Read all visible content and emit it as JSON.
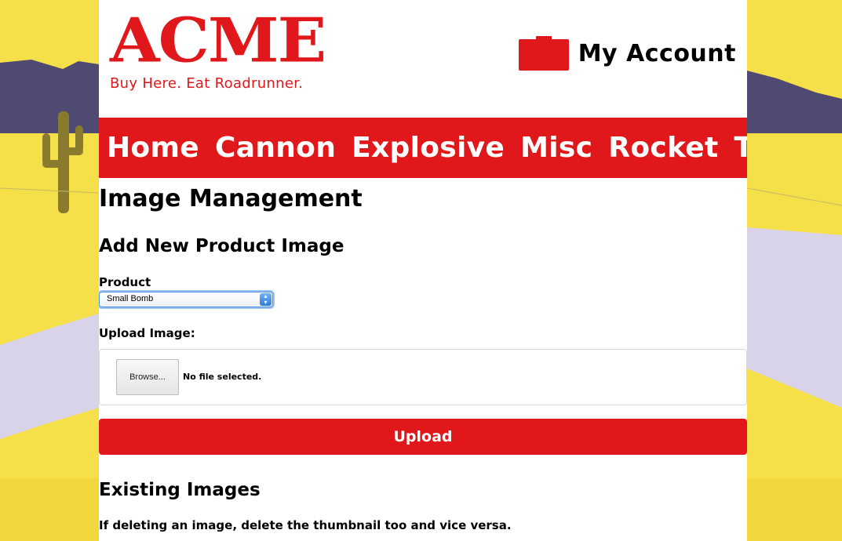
{
  "brand": {
    "name": "ACME",
    "tagline": "Buy Here. Eat Roadrunner.",
    "accent_color": "#e0181b"
  },
  "account": {
    "label": "My Account",
    "icon": "folder-icon"
  },
  "nav": {
    "items": [
      {
        "label": "Home"
      },
      {
        "label": "Cannon"
      },
      {
        "label": "Explosive"
      },
      {
        "label": "Misc"
      },
      {
        "label": "Rocket"
      },
      {
        "label": "Trap"
      }
    ]
  },
  "main": {
    "title": "Image Management",
    "add_section": {
      "title": "Add New Product Image",
      "product_label": "Product",
      "product_selected": "Small Bomb",
      "upload_label": "Upload Image:",
      "browse_label": "Browse...",
      "file_status": "No file selected.",
      "upload_button": "Upload"
    },
    "existing_section": {
      "title": "Existing Images",
      "note": "If deleting an image, delete the thumbnail too and vice versa."
    }
  }
}
